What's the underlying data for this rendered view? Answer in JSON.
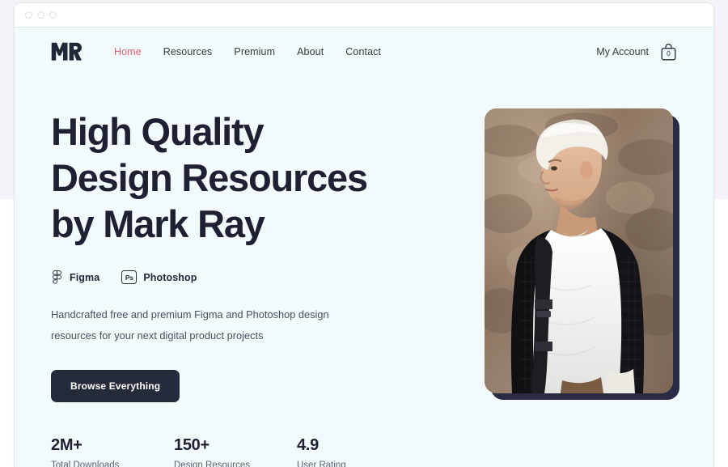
{
  "browser": {
    "traffic_lights": [
      "close",
      "minimize",
      "maximize"
    ]
  },
  "nav": {
    "logo_text": "MR",
    "links": [
      {
        "label": "Home",
        "active": true
      },
      {
        "label": "Resources",
        "active": false
      },
      {
        "label": "Premium",
        "active": false
      },
      {
        "label": "About",
        "active": false
      },
      {
        "label": "Contact",
        "active": false
      }
    ],
    "account_label": "My Account",
    "cart_count": "0"
  },
  "hero": {
    "headline": "High Quality\nDesign Resources\nby Mark Ray",
    "badges": [
      {
        "icon": "figma-icon",
        "label": "Figma"
      },
      {
        "icon": "photoshop-icon",
        "label": "Photoshop",
        "glyph": "Ps"
      }
    ],
    "lede": "Handcrafted free and premium Figma and Photoshop design resources for your next digital product projects",
    "cta_label": "Browse Everything",
    "image_alt": "Portrait of a man with platinum blond hair wearing a black knit cardigan and white t-shirt with a backpack, standing in front of a blurred stone wall"
  },
  "stats": [
    {
      "value": "2M+",
      "label": "Total Downloads"
    },
    {
      "value": "150+",
      "label": "Design Resources"
    },
    {
      "value": "4.9",
      "label": "User Rating"
    }
  ],
  "colors": {
    "accent": "#e16073",
    "ink": "#1e2133",
    "button": "#262b3c",
    "page_bg": "#f2fafc",
    "backdrop": "#f4f3f7",
    "frame": "#2b2b46"
  }
}
